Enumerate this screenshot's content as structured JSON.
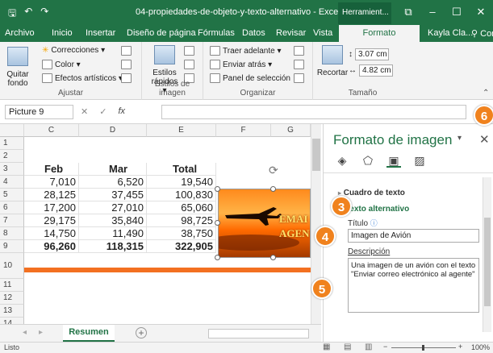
{
  "window": {
    "title": "04-propiedades-de-objeto-y-texto-alternativo - Excel",
    "tools_tab": "Herramient...",
    "min": "–",
    "restore": "☐",
    "close": "✕"
  },
  "tabs": [
    {
      "label": "Archivo"
    },
    {
      "label": "Inicio"
    },
    {
      "label": "Insertar"
    },
    {
      "label": "Diseño de página"
    },
    {
      "label": "Fórmulas"
    },
    {
      "label": "Datos"
    },
    {
      "label": "Revisar"
    },
    {
      "label": "Vista"
    },
    {
      "label": "Formato"
    }
  ],
  "user": {
    "name": "Kayla Cla...",
    "share": "Con"
  },
  "ribbon": {
    "quitar_fondo": "Quitar fondo",
    "correcciones": "Correcciones ▾",
    "color": "Color ▾",
    "efectos": "Efectos artísticos ▾",
    "group_ajustar": "Ajustar",
    "estilos_rapidos": "Estilos rápidos ▾",
    "group_estilos": "Estilos de imagen",
    "traer": "Traer adelante ▾",
    "enviar": "Enviar atrás ▾",
    "panel": "Panel de selección",
    "group_organizar": "Organizar",
    "recortar": "Recortar",
    "height": "3.07 cm",
    "width": "4.82 cm",
    "group_tamano": "Tamaño"
  },
  "formula": {
    "namebox": "Picture 9",
    "cancel": "✕",
    "enter": "✓",
    "fx": "fx"
  },
  "grid": {
    "columns": [
      "C",
      "D",
      "E",
      "F",
      "G"
    ],
    "rows": [
      "1",
      "2",
      "3",
      "4",
      "5",
      "6",
      "7",
      "8",
      "9",
      "10",
      "11",
      "12",
      "13",
      "14"
    ],
    "headers": [
      "Feb",
      "Mar",
      "Total"
    ],
    "data": [
      [
        "7,010",
        "6,520",
        "19,540"
      ],
      [
        "28,125",
        "37,455",
        "100,830"
      ],
      [
        "17,200",
        "27,010",
        "65,060"
      ],
      [
        "29,175",
        "35,840",
        "98,725"
      ],
      [
        "14,750",
        "11,490",
        "38,750"
      ],
      [
        "96,260",
        "118,315",
        "322,905"
      ]
    ],
    "picture_text": [
      "EMAI",
      "AGEN"
    ]
  },
  "sheet": {
    "tab": "Resumen",
    "add": "+"
  },
  "status": {
    "ready": "Listo",
    "zoom": "100%"
  },
  "pane": {
    "title": "Formato de imagen",
    "section_cuadro": "Cuadro de texto",
    "section_alt": "Texto alternativo",
    "titulo_label": "Título",
    "titulo_value": "Imagen de Avión",
    "descripcion_label": "Descripción",
    "descripcion_value": "Una imagen de un avión con el texto \"Enviar correo electrónico al agente\""
  },
  "callouts": [
    "3",
    "4",
    "5",
    "6"
  ],
  "colors": {
    "excel_green": "#217346",
    "callout": "#f0821e"
  }
}
